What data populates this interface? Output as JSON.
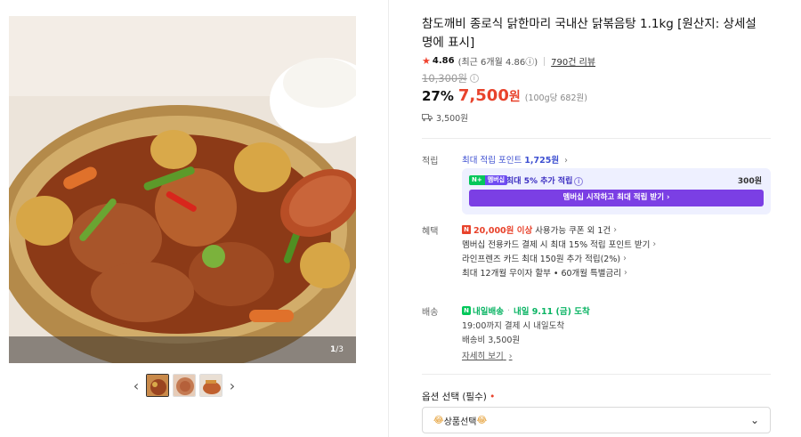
{
  "gallery": {
    "counter_current": "1",
    "counter_total": "/3",
    "prev_label": "‹",
    "next_label": "›"
  },
  "product": {
    "title": "참도깨비 종로식 닭한마리 국내산 닭볶음탕 1.1kg [원산지: 상세설명에 표시]",
    "rating": "4.86",
    "rating_recent": "(최근 6개월 4.86ⓘ)",
    "review_count": "790건 리뷰",
    "original_price": "10,300원",
    "discount_rate": "27%",
    "sale_price": "7,500",
    "won": "원",
    "unit_price": "(100g당 682원)",
    "shipping_fee": "3,500원"
  },
  "points": {
    "label": "적립",
    "max_points_prefix": "최대 적립 포인트",
    "max_points_value": "1,725원",
    "badge_n": "N+",
    "badge_membership": "멤버십",
    "extra_text": "최대 5% 추가 적립",
    "extra_amount": "300원",
    "member_button": "멤버십 시작하고 최대 적립 받기 ›"
  },
  "benefits": {
    "label": "혜택",
    "coupon_badge": "N",
    "coupon_strong": "20,000원 이상",
    "coupon_rest": "사용가능 쿠폰 외 1건",
    "items": [
      "멤버십 전용카드 결제 시 최대 15% 적립 포인트 받기",
      "라인프렌즈 카드 최대 150원 추가 적립(2%)",
      "최대 12개월 무이자 할부 • 60개월 특별금리"
    ]
  },
  "delivery": {
    "label": "배송",
    "badge_icon": "N",
    "badge_text": "내일배송",
    "arrive": "내일 9.11 (금) 도착",
    "cutoff": "19:00까지 결제 시 내일도착",
    "fee": "배송비 3,500원",
    "detail_link": "자세히 보기"
  },
  "option": {
    "label": "옵션 선택 (필수)",
    "required_mark": "•",
    "selected": "상품선택",
    "emoji_left": "😂",
    "emoji_right": "😂"
  },
  "icons": {
    "star": "star-icon",
    "truck": "truck-icon",
    "chevron": "chevron-right-icon"
  },
  "colors": {
    "sale_red": "#e8432c",
    "points_blue": "#3d4fd1",
    "membership_purple": "#7b3fe4",
    "naver_green": "#03c75a"
  }
}
